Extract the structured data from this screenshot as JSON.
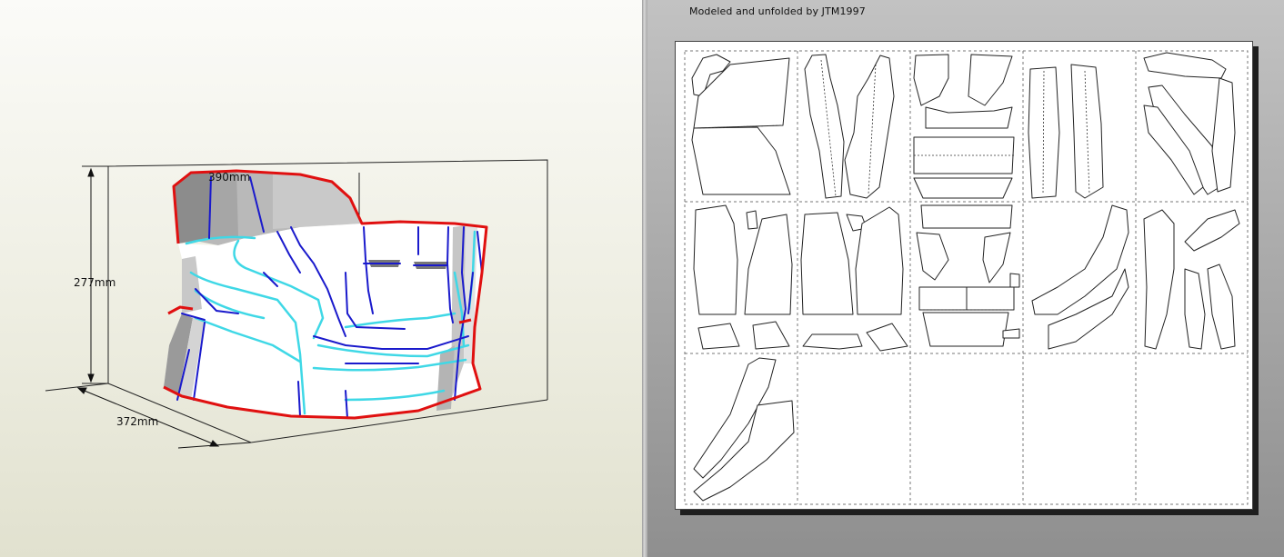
{
  "model_view": {
    "dimensions": {
      "width_label": "390mm",
      "height_label": "277mm",
      "depth_label": "372mm"
    },
    "colors": {
      "cut_edge": "#e01010",
      "mountain_fold": "#1a1acc",
      "valley_fold": "#3fd8e6",
      "face_fill": "#ffffff",
      "shade_dark": "#8a8a8a",
      "shade_light": "#d6d6d6"
    }
  },
  "unfold_view": {
    "credit": "Modeled and unfolded by JTM1997",
    "grid": {
      "columns": 5,
      "rows": 3
    }
  }
}
